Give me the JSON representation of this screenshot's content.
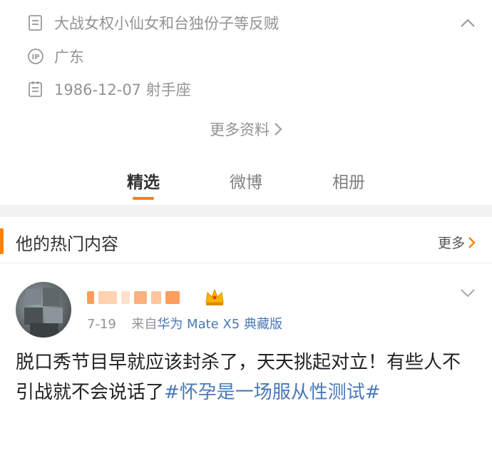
{
  "profile": {
    "bio": "大战女权小仙女和台独份子等反贼",
    "ip_location": "广东",
    "birthday": "1986-12-07 射手座",
    "more_info_label": "更多资料"
  },
  "tabs": [
    {
      "label": "精选"
    },
    {
      "label": "微博"
    },
    {
      "label": "相册"
    }
  ],
  "hot_section": {
    "title": "他的热门内容",
    "more_label": "更多"
  },
  "post": {
    "date": "7-19",
    "source_prefix": "来自",
    "source": "华为 Mate X5 典藏版",
    "text": "脱口秀节目早就应该封杀了，天天挑起对立！有些人不引战就不会说话了",
    "hashtag": "#怀孕是一场服从性测试#"
  },
  "colors": {
    "accent": "#ff8200",
    "link": "#4a78b8",
    "muted": "#939393"
  }
}
